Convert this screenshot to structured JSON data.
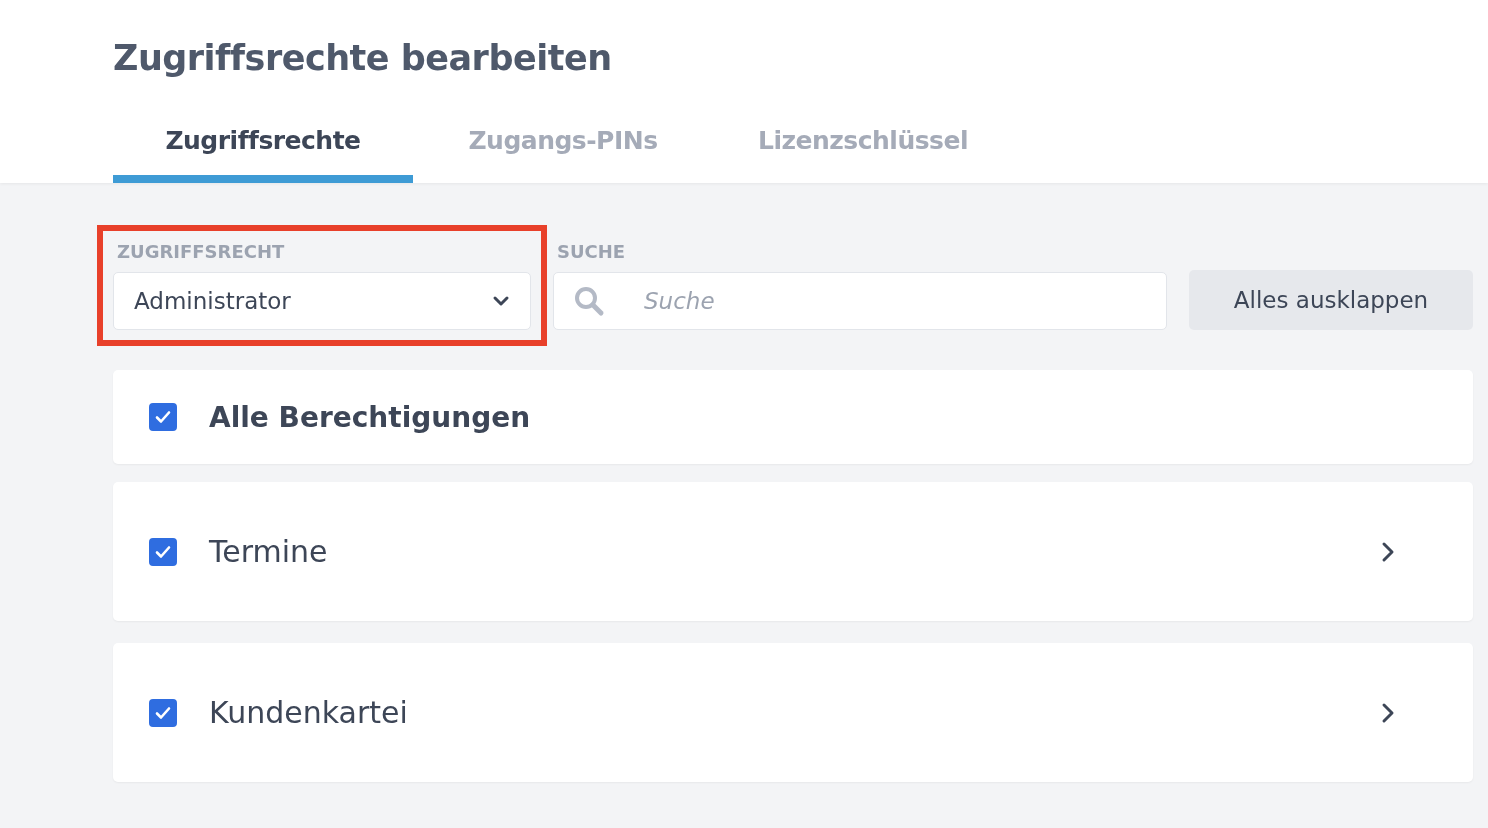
{
  "page": {
    "title": "Zugriffsrechte bearbeiten"
  },
  "tabs": [
    {
      "label": "Zugriffsrechte",
      "selected": true
    },
    {
      "label": "Zugangs-PINs",
      "selected": false
    },
    {
      "label": "Lizenzschlüssel",
      "selected": false
    }
  ],
  "filter": {
    "label": "ZUGRIFFSRECHT",
    "value": "Administrator",
    "highlighted": true
  },
  "search": {
    "label": "SUCHE",
    "placeholder": "Suche"
  },
  "expand_button": "Alles ausklappen",
  "permissions": [
    {
      "kind": "all",
      "label": "Alle Berechtigungen",
      "checked": true
    },
    {
      "kind": "group",
      "label": "Termine",
      "checked": true
    },
    {
      "kind": "group",
      "label": "Kundenkartei",
      "checked": true
    }
  ]
}
